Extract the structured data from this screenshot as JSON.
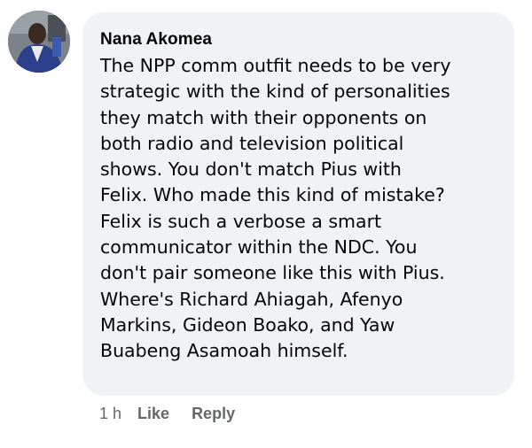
{
  "comment": {
    "author": "Nana Akomea",
    "avatar_icon": "user-avatar-photo",
    "lines": [
      "The NPP comm outfit needs to be very",
      "strategic with the kind of personalities",
      "they match with their opponents on",
      "both radio and television political",
      "shows. You don't match Pius with",
      "Felix. Who made this kind of mistake?",
      "Felix is such a verbose a smart",
      "communicator within the NDC. You",
      "don't pair someone like this with Pius.",
      "Where's Richard Ahiagah, Afenyo",
      "Markins, Gideon Boako, and Yaw",
      "Buabeng Asamoah himself."
    ],
    "timestamp": "1 h",
    "like_label": "Like",
    "reply_label": "Reply"
  },
  "colors": {
    "bubble_background": "#f0f2f5",
    "text": "#050505",
    "secondary_text": "#65676b"
  }
}
